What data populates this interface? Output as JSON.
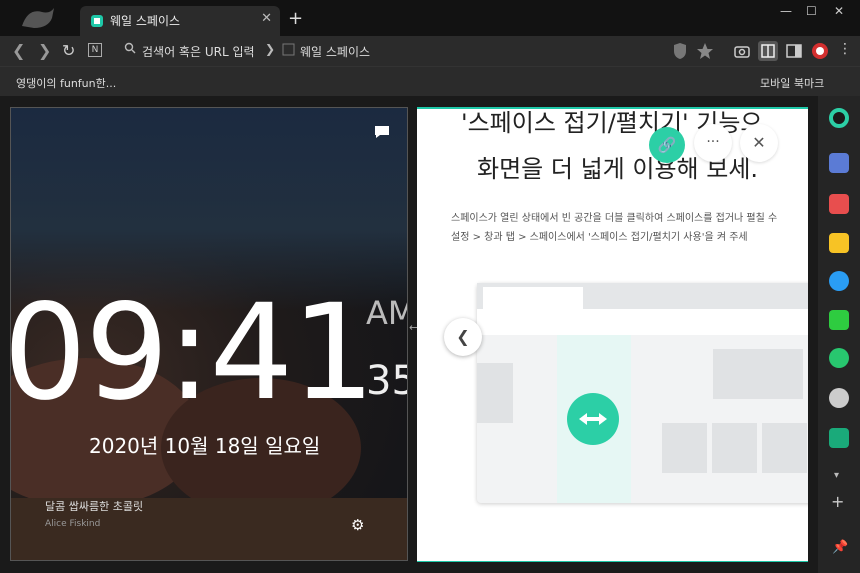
{
  "tab": {
    "title": "웨일 스페이스",
    "close": "✕",
    "new": "+"
  },
  "window": {
    "minimize": "—",
    "maximize": "☐",
    "close": "✕"
  },
  "toolbar": {
    "back": "❮",
    "forward": "❯",
    "reload": "↻",
    "naver": "N",
    "placeholder": "검색어 혹은 URL 입력",
    "sep": "❯",
    "page": "웨일 스페이스"
  },
  "bookmarks": {
    "first": "영댕이의 funfun한...",
    "mobile": "모바일 북마크"
  },
  "clock": {
    "time": "09:41",
    "ampm": "AM",
    "seconds": "35",
    "date": "2020년 10월 18일 일요일",
    "caption": "달콤 쌉싸름한 초콜릿",
    "credit": "Alice Fiskind"
  },
  "space": {
    "heading1": "'스페이스 접기/펼치기' 기능으",
    "heading2": "화면을 더 넓게 이용해 보세.",
    "para1": "스페이스가 열린 상태에서 빈 공간을 더블 클릭하여 스페이스를 접거나 펼칠 수",
    "para2": "설정 > 창과 탭 > 스페이스에서 '스페이스 접기/펼치기 사용'을 켜 주세",
    "prev": "❮",
    "link": "🔗",
    "more": "···",
    "close": "✕"
  },
  "sidebar": {
    "more": "▾",
    "add": "+"
  },
  "colors": {
    "accent": "#1ec8a8",
    "tabbar": "#121212",
    "toolbar": "#2b2b2b"
  }
}
